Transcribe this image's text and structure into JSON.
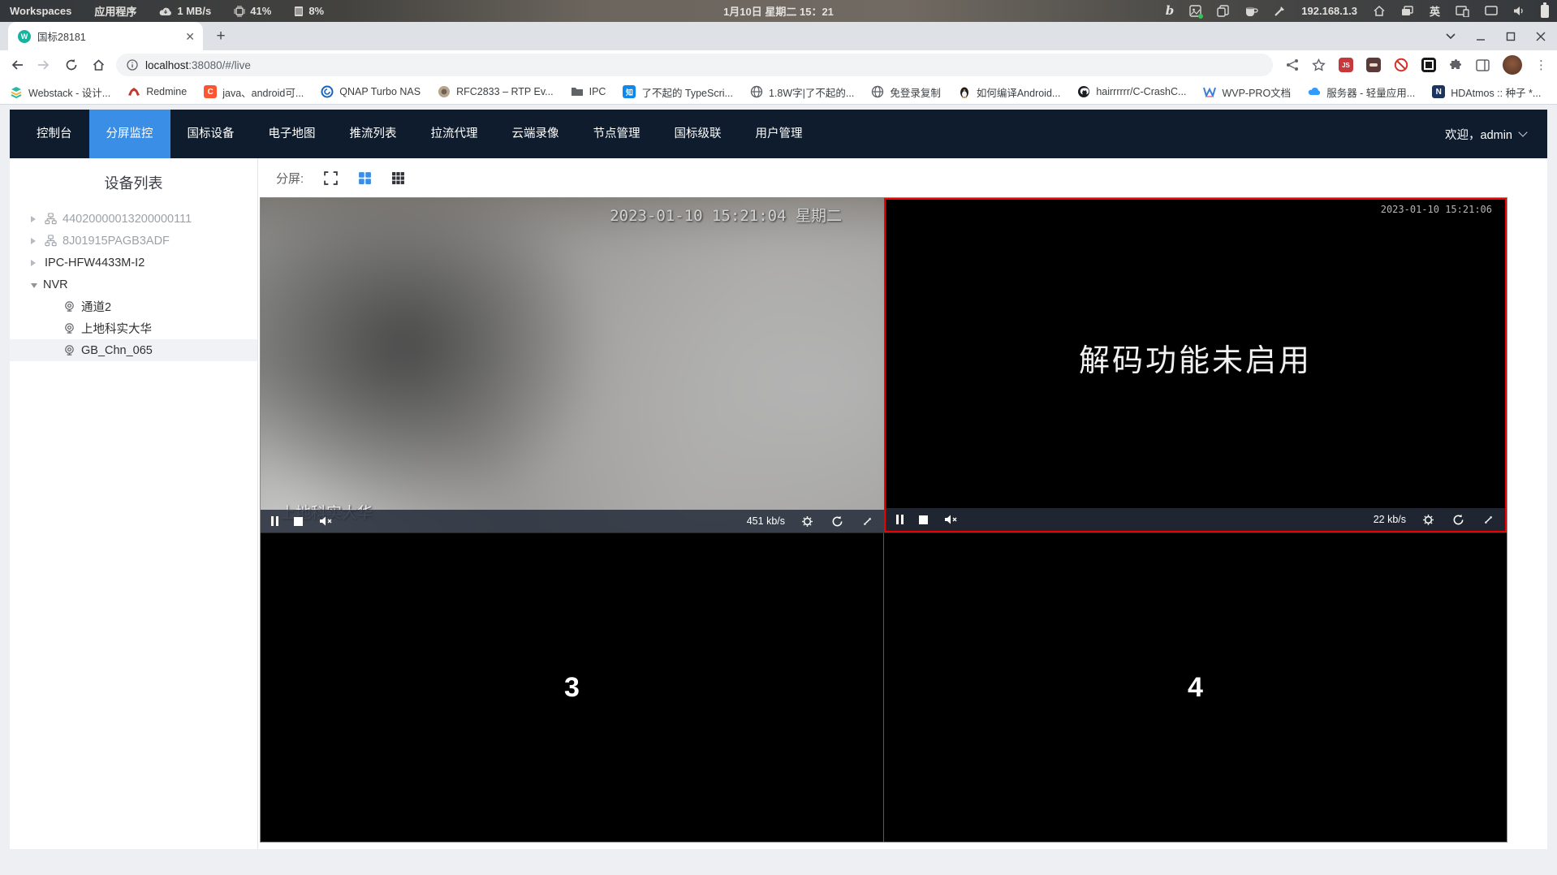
{
  "desktop": {
    "topbar": {
      "workspaces_label": "Workspaces",
      "apps_label": "应用程序",
      "net_speed": "1 MB/s",
      "cpu_usage": "41%",
      "mem_usage": "8%",
      "clock": "1月10日 星期二 15：21",
      "ip_address": "192.168.1.3",
      "ime_label": "英"
    }
  },
  "browser": {
    "tab_title": "国标28181",
    "tab_favicon_glyph": "W",
    "new_tab_glyph": "+",
    "url_host": "localhost",
    "url_rest": ":38080/#/live",
    "bookmarks": [
      {
        "label": "Webstack - 设计..."
      },
      {
        "label": "Redmine"
      },
      {
        "label": "java、android可..."
      },
      {
        "label": "QNAP Turbo NAS"
      },
      {
        "label": "RFC2833 – RTP Ev..."
      },
      {
        "label": "IPC"
      },
      {
        "label": "了不起的 TypeScri..."
      },
      {
        "label": "1.8W字|了不起的..."
      },
      {
        "label": "免登录复制"
      },
      {
        "label": "如何编译Android..."
      },
      {
        "label": "hairrrrrr/C-CrashC..."
      },
      {
        "label": "WVP-PRO文档"
      },
      {
        "label": "服务器 - 轻量应用..."
      },
      {
        "label": "HDAtmos :: 种子 *..."
      }
    ],
    "bookmarks_overflow": "»"
  },
  "app": {
    "nav": {
      "items": [
        {
          "label": "控制台"
        },
        {
          "label": "分屏监控"
        },
        {
          "label": "国标设备"
        },
        {
          "label": "电子地图"
        },
        {
          "label": "推流列表"
        },
        {
          "label": "拉流代理"
        },
        {
          "label": "云端录像"
        },
        {
          "label": "节点管理"
        },
        {
          "label": "国标级联"
        },
        {
          "label": "用户管理"
        }
      ],
      "active": "分屏监控",
      "welcome": "欢迎，admin"
    },
    "sidebar": {
      "title": "设备列表",
      "tree": [
        {
          "label": "44020000013200000111",
          "online": false
        },
        {
          "label": "8J01915PAGB3ADF",
          "online": false
        },
        {
          "label": "IPC-HFW4433M-I2",
          "online": true
        },
        {
          "label": "NVR",
          "online": true,
          "expanded": true,
          "children": [
            {
              "label": "通道2"
            },
            {
              "label": "上地科实大华"
            },
            {
              "label": "GB_Chn_065",
              "selected": true
            }
          ]
        }
      ]
    },
    "toolbar": {
      "split_label": "分屏:"
    },
    "players": {
      "v1": {
        "osd_timestamp": "2023-01-10 15:21:04 星期二",
        "osd_name": "上地科实大华",
        "bitrate": "451 kb/s"
      },
      "v2": {
        "osd_timestamp": "2023-01-10 15:21:06",
        "message": "解码功能未启用",
        "bitrate": "22 kb/s"
      },
      "v3": {
        "label": "3"
      },
      "v4": {
        "label": "4"
      }
    },
    "colors": {
      "accent_blue": "#3a8ee6",
      "nav_bg": "#0e1c2e",
      "selected_border_red": "#f20000"
    }
  }
}
